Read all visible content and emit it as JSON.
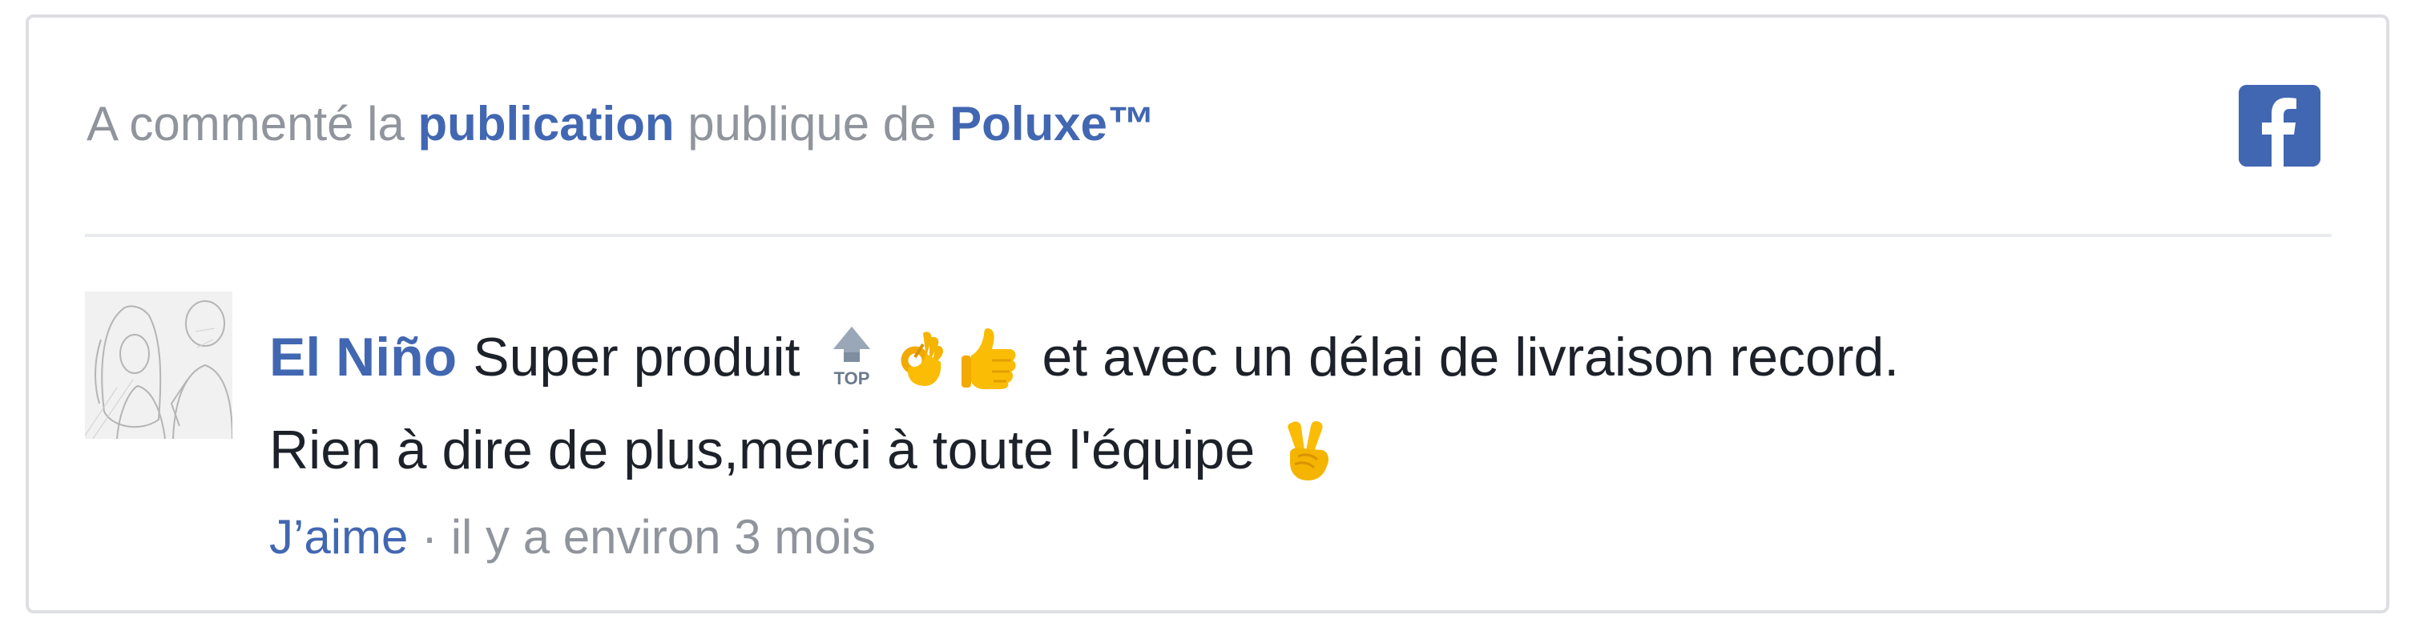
{
  "header": {
    "prefix": "A commenté la",
    "post_link": "publication",
    "middle": "publique de",
    "page_link": "Poluxe™"
  },
  "comment": {
    "author": "El Niño",
    "text_part1": "Super produit",
    "text_part2": "et avec un délai de livraison record.",
    "text_line2": "Rien à dire de plus,merci à toute l'équipe",
    "emoji_top_label": "TOP"
  },
  "actions": {
    "like": "J’aime",
    "separator": "·",
    "timestamp": "il y a environ 3 mois"
  },
  "colors": {
    "link": "#4267b2",
    "muted": "#90949c",
    "text": "#1d2129",
    "border": "#dddfe2",
    "facebook": "#4267b2"
  },
  "icons": [
    "facebook-icon",
    "top-arrow-emoji",
    "ok-hand-emoji",
    "thumbs-up-emoji",
    "victory-hand-emoji"
  ]
}
